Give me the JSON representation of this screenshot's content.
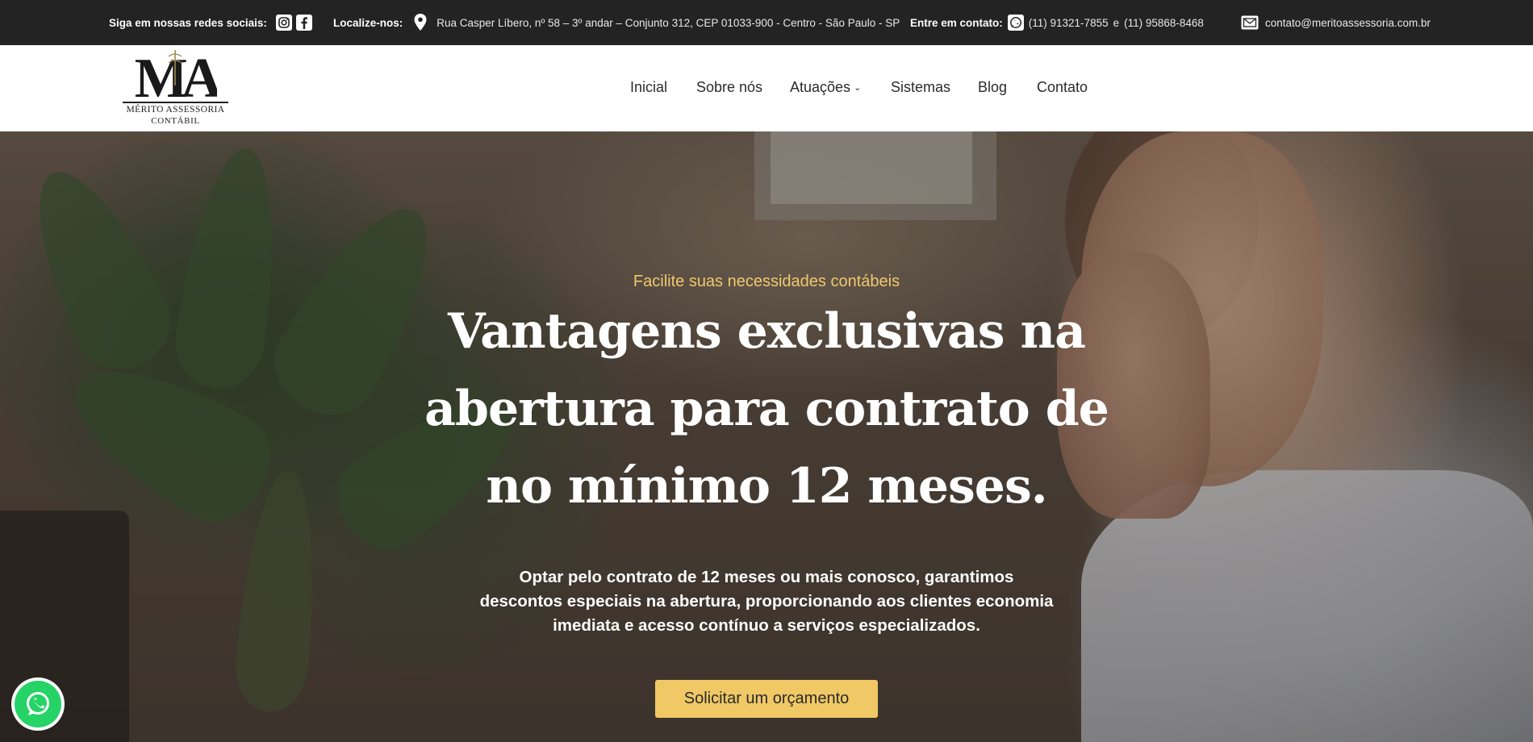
{
  "topbar": {
    "social_label": "Siga em nossas redes sociais:",
    "location_label": "Localize-nos:",
    "address": "Rua Casper Líbero, nº 58 – 3º andar – Conjunto 312, CEP 01033-900 - Centro - São Paulo - SP",
    "contact_label": "Entre em contato:",
    "phone1": "(11) 91321-7855",
    "phone_sep": "e",
    "phone2": "(11) 95868-8468",
    "email": "contato@meritoassessoria.com.br",
    "icons": [
      "instagram-icon",
      "facebook-icon",
      "location-pin-icon",
      "whatsapp-icon",
      "mail-icon"
    ]
  },
  "header": {
    "logo_mark": "MA",
    "logo_line1": "MÉRITO ASSESSORIA",
    "logo_line2": "CONTÁBIL",
    "nav": [
      {
        "label": "Inicial"
      },
      {
        "label": "Sobre nós"
      },
      {
        "label": "Atuações"
      },
      {
        "label": "Sistemas"
      },
      {
        "label": "Blog"
      },
      {
        "label": "Contato"
      }
    ]
  },
  "hero": {
    "subtitle": "Facilite suas necessidades contábeis",
    "title": "Vantagens exclusivas na abertura para contrato de no mínimo 12 meses.",
    "text": "Optar pelo contrato de 12 meses ou mais conosco, garantimos descontos especiais na abertura, proporcionando aos clientes economia imediata e acesso contínuo a serviços especializados.",
    "cta_label": "Solicitar um orçamento"
  },
  "colors": {
    "topbar_bg": "#232323",
    "accent": "#f0c865",
    "subtitle": "#f0c86e",
    "whatsapp": "#25d366"
  }
}
